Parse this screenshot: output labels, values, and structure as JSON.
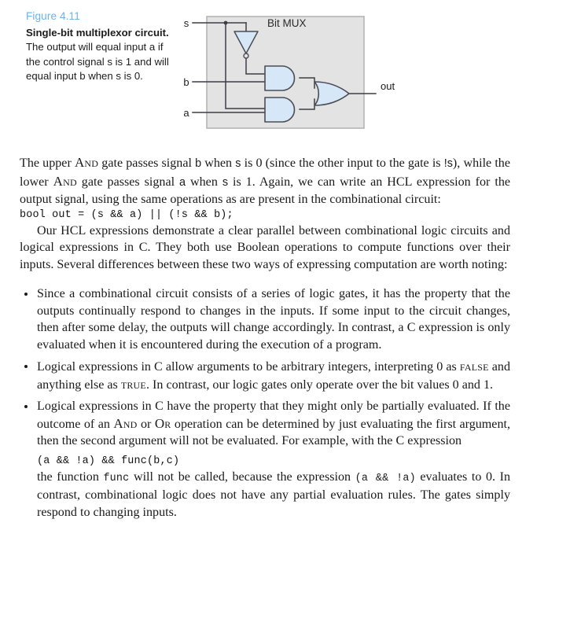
{
  "figure": {
    "number": "Figure 4.11",
    "title": "Single-bit multiplexor circuit.",
    "caption_rest": " The output will equal input a if the control signal s is 1 and will equal input b when s is 0.",
    "diagram": {
      "box_label": "Bit MUX",
      "inputs": [
        "s",
        "b",
        "a"
      ],
      "output": "out",
      "gates": [
        "not-gate",
        "and-gate",
        "and-gate",
        "or-gate"
      ],
      "colors": {
        "box_fill": "#e3e3e3",
        "box_border": "#b5b5b5",
        "gate_fill": "#d6e8f7",
        "gate_stroke": "#4c4c56",
        "wire": "#3c3c44"
      }
    }
  },
  "body": {
    "para1_a": "The upper ",
    "para1_and1": "And",
    "para1_b": " gate passes signal ",
    "para1_var_b": "b",
    "para1_c": " when ",
    "para1_var_s1": "s",
    "para1_d": " is 0 (since the other input to the gate is ",
    "para1_var_ns": "!s",
    "para1_e": "), while the lower ",
    "para1_and2": "And",
    "para1_f": " gate passes signal ",
    "para1_var_a": "a",
    "para1_g": " when ",
    "para1_var_s2": "s",
    "para1_h": " is 1. Again, we can write an HCL expression for the output signal, using the same operations as are present in the combinational circuit:",
    "code1": "bool out = (s && a) || (!s && b);",
    "para2": "Our HCL expressions demonstrate a clear parallel between combinational logic circuits and logical expressions in C. They both use Boolean operations to compute functions over their inputs. Several differences between these two ways of expressing computation are worth noting:",
    "bullet1": "Since a combinational circuit consists of a series of logic gates, it has the property that the outputs continually respond to changes in the inputs. If some input to the circuit changes, then after some delay, the outputs will change accordingly. In contrast, a C expression is only evaluated when it is encountered during the execution of a program.",
    "bullet2_a": "Logical expressions in C allow arguments to be arbitrary integers, interpreting 0 as ",
    "bullet2_false": "false",
    "bullet2_b": " and anything else as ",
    "bullet2_true": "true",
    "bullet2_c": ". In contrast, our logic gates only operate over the bit values 0 and 1.",
    "bullet3_a": "Logical expressions in C have the property that they might only be partially evaluated. If the outcome of an ",
    "bullet3_and": "And",
    "bullet3_b": " or ",
    "bullet3_or": "Or",
    "bullet3_c": " operation can be determined by just evaluating the first argument, then the second argument will not be evaluated. For example, with the C expression",
    "code2": "(a && !a) && func(b,c)",
    "para3_a": "the function ",
    "para3_func": "func",
    "para3_b": " will not be called, because the expression ",
    "para3_expr": "(a && !a)",
    "para3_c": " evaluates to 0. In contrast, combinational logic does not have any partial evaluation rules. The gates simply respond to changing inputs."
  }
}
